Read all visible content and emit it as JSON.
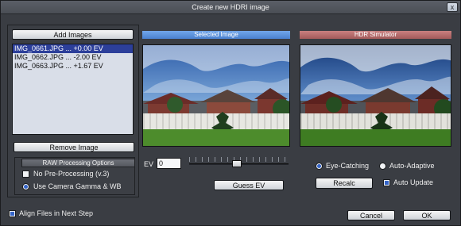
{
  "window": {
    "title": "Create new HDRI image",
    "close_label": "x"
  },
  "left": {
    "add_images_label": "Add Images",
    "remove_image_label": "Remove Image",
    "files": [
      {
        "label": "IMG_0661.JPG ... +0.00 EV",
        "selected": true
      },
      {
        "label": "IMG_0662.JPG ... -2.00 EV",
        "selected": false
      },
      {
        "label": "IMG_0663.JPG ... +1.67 EV",
        "selected": false
      }
    ]
  },
  "raw": {
    "title": "RAW Processing Options",
    "options": [
      {
        "label": "No Pre-Processing (v.3)",
        "checked": false
      },
      {
        "label": "Use Camera Gamma & WB",
        "checked": true
      }
    ]
  },
  "selected": {
    "title": "Selected Image",
    "ev_label": "EV",
    "ev_value": "0",
    "slider_level": 0.5,
    "guess_ev_label": "Guess EV"
  },
  "hdr": {
    "title": "HDR Simulator",
    "mode_options": [
      {
        "label": "Eye-Catching",
        "checked": true
      },
      {
        "label": "Auto-Adaptive",
        "checked": false
      }
    ],
    "recalc_label": "Recalc",
    "auto_update": {
      "label": "Auto Update",
      "checked": true
    }
  },
  "footer": {
    "align_files": {
      "label": "Align Files in Next Step",
      "checked": true
    },
    "cancel_label": "Cancel",
    "ok_label": "OK"
  },
  "colors": {
    "accent_blue": "#4a80cf",
    "accent_red": "#a25a5a",
    "selection": "#2c3f9a"
  }
}
